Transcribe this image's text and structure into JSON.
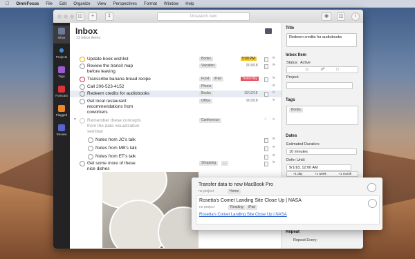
{
  "menubar": {
    "app": "OmniFocus",
    "items": [
      "File",
      "Edit",
      "Organize",
      "View",
      "Perspectives",
      "Format",
      "Window",
      "Help"
    ]
  },
  "toolbar": {
    "search_placeholder": "Onsearch new"
  },
  "sidebar": {
    "items": [
      "Inbox",
      "Projects",
      "Tags",
      "Forecast",
      "Flagged",
      "Review"
    ]
  },
  "outline": {
    "title": "Inbox",
    "count": "11 inbox items"
  },
  "rows": [
    {
      "text": "Update book wishlist",
      "tag": "Books",
      "date": "5:00 PM",
      "date_style": "due-soon"
    },
    {
      "text": "Review the transit map",
      "text2": "before leaving",
      "tag": "Vacation",
      "date": "9/19/18"
    },
    {
      "text": "Transcribe banana bread recipe",
      "tag": "Food",
      "tag2": "iPad",
      "date": "Yesterday",
      "date_style": "overdue"
    },
    {
      "text": "Call 206-523-4152",
      "tag": "Phone"
    },
    {
      "text": "Redeem credits for audiobooks",
      "tag": "Books",
      "date": "10/12/18"
    },
    {
      "text": "Get local restaurant",
      "text2": "recommendations from",
      "text3": "coworkers",
      "tag": "Office",
      "date": "9/15/18"
    },
    {
      "text": "Remember these concepts",
      "text2": "from the data visualization",
      "text3": "seminar",
      "tag": "Conference"
    },
    {
      "text": "Notes from JC's talk"
    },
    {
      "text": "Notes from MB's talk"
    },
    {
      "text": "Notes from ET's talk"
    },
    {
      "text": "Get some more of these",
      "text2": "nice dishes",
      "tag": "Shopping",
      "tag2": "..."
    }
  ],
  "inspector": {
    "title_header": "Title",
    "title_value": "Redeem credits for audiobooks",
    "inbox_header": "Inbox Item",
    "status_label": "Status:",
    "status_value": "Active",
    "project_label": "Project:",
    "tags_header": "Tags",
    "tag_token": "Books",
    "dates_header": "Dates",
    "estimated_label": "Estimated Duration:",
    "estimated_value": "10 minutes",
    "defer_label": "Defer Until:",
    "defer_value": "9/1/18, 12:00 AM",
    "defer_buttons": [
      "+1 day",
      "+1 week",
      "+1 month"
    ],
    "repeat_header": "Repeat",
    "repeat_label": "Repeat Every:"
  },
  "popup": {
    "item1": "Transfer data to new MacBook Pro",
    "item1_project": "no project",
    "item1_tag": "Home",
    "item2": "Rosetta's Comet Landing Site Close Up | NASA",
    "item2_project": "no project",
    "item2_tag": "Reading",
    "item2_tag2": "iPad",
    "item2_link": "Rosetta's Comet Landing Site Close Up | NASA"
  }
}
